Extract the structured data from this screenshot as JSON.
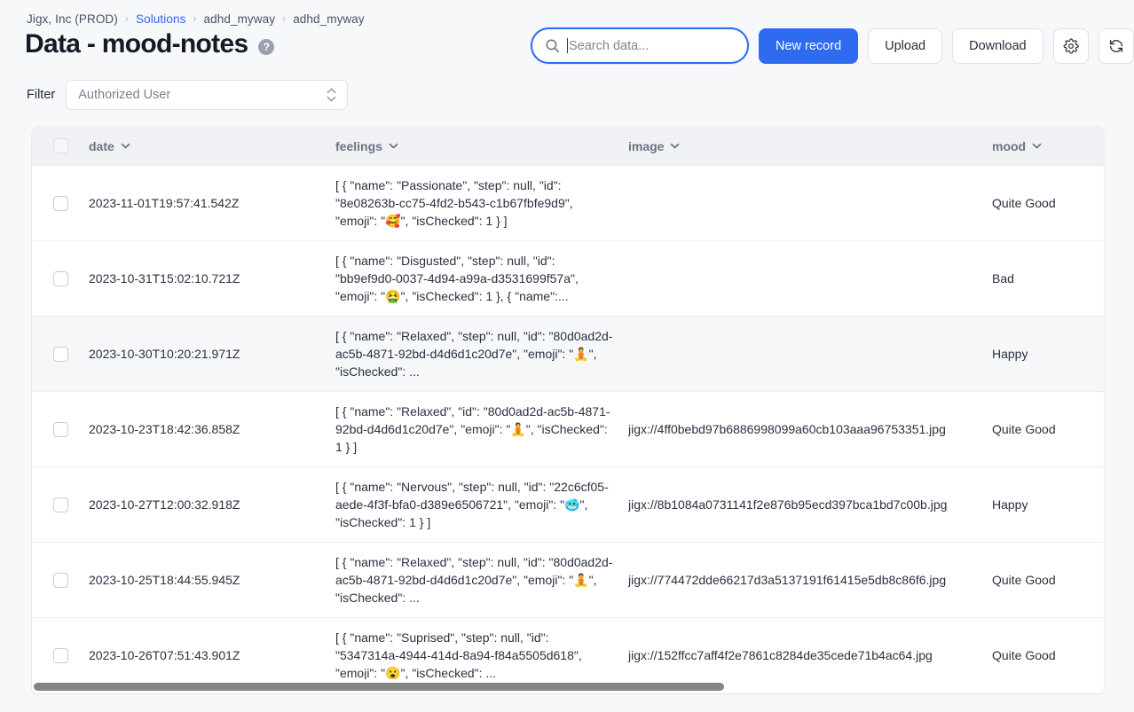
{
  "breadcrumb": {
    "items": [
      {
        "label": "Jigx, Inc (PROD)",
        "link": false
      },
      {
        "label": "Solutions",
        "link": true
      },
      {
        "label": "adhd_myway",
        "link": false
      },
      {
        "label": "adhd_myway",
        "link": false
      }
    ],
    "separator": "›"
  },
  "header": {
    "title": "Data - mood-notes",
    "help_glyph": "?"
  },
  "toolbar": {
    "search": {
      "placeholder": "Search data...",
      "value": "",
      "icon": "search-icon"
    },
    "new_record_label": "New record",
    "upload_label": "Upload",
    "download_label": "Download",
    "settings_icon": "gear-icon",
    "refresh_icon": "refresh-icon"
  },
  "filter": {
    "label": "Filter",
    "value": "Authorized User",
    "options": [
      "Authorized User"
    ]
  },
  "table": {
    "columns": [
      {
        "key": "date",
        "label": "date"
      },
      {
        "key": "feelings",
        "label": "feelings"
      },
      {
        "key": "image",
        "label": "image"
      },
      {
        "key": "mood",
        "label": "mood"
      }
    ],
    "rows": [
      {
        "date": "2023-11-01T19:57:41.542Z",
        "feelings": "[ { \"name\": \"Passionate\", \"step\": null, \"id\": \"8e08263b-cc75-4fd2-b543-c1b67fbfe9d9\", \"emoji\": \"🥰\", \"isChecked\": 1 } ]",
        "image": "",
        "mood": "Quite Good",
        "hover": false
      },
      {
        "date": "2023-10-31T15:02:10.721Z",
        "feelings": "[ { \"name\": \"Disgusted\", \"step\": null, \"id\": \"bb9ef9d0-0037-4d94-a99a-d3531699f57a\", \"emoji\": \"🤮\", \"isChecked\": 1 }, { \"name\":...",
        "image": "",
        "mood": "Bad",
        "hover": false
      },
      {
        "date": "2023-10-30T10:20:21.971Z",
        "feelings": "[ { \"name\": \"Relaxed\", \"step\": null, \"id\": \"80d0ad2d-ac5b-4871-92bd-d4d6d1c20d7e\", \"emoji\": \"🧘\", \"isChecked\": ...",
        "image": "",
        "mood": "Happy",
        "hover": true
      },
      {
        "date": "2023-10-23T18:42:36.858Z",
        "feelings": "[ { \"name\": \"Relaxed\", \"id\": \"80d0ad2d-ac5b-4871-92bd-d4d6d1c20d7e\", \"emoji\": \"🧘\", \"isChecked\": 1 } ]",
        "image": "jigx://4ff0bebd97b6886998099a60cb103aaa96753351.jpg",
        "mood": "Quite Good",
        "hover": false
      },
      {
        "date": "2023-10-27T12:00:32.918Z",
        "feelings": "[ { \"name\": \"Nervous\", \"step\": null, \"id\": \"22c6cf05-aede-4f3f-bfa0-d389e6506721\", \"emoji\": \"🥶\", \"isChecked\": 1 } ]",
        "image": "jigx://8b1084a0731141f2e876b95ecd397bca1bd7c00b.jpg",
        "mood": "Happy",
        "hover": false
      },
      {
        "date": "2023-10-25T18:44:55.945Z",
        "feelings": "[ { \"name\": \"Relaxed\", \"step\": null, \"id\": \"80d0ad2d-ac5b-4871-92bd-d4d6d1c20d7e\", \"emoji\": \"🧘\", \"isChecked\": ...",
        "image": "jigx://774472dde66217d3a5137191f61415e5db8c86f6.jpg",
        "mood": "Quite Good",
        "hover": false
      },
      {
        "date": "2023-10-26T07:51:43.901Z",
        "feelings": "[ { \"name\": \"Suprised\", \"step\": null, \"id\": \"5347314a-4944-414d-8a94-f84a5505d618\", \"emoji\": \"😮\", \"isChecked\": ...",
        "image": "jigx://152ffcc7aff4f2e7861c8284de35cede71b4ac64.jpg",
        "mood": "Quite Good",
        "hover": false
      }
    ]
  },
  "colors": {
    "accent": "#2f6bf0",
    "link": "#3063f2",
    "page_bg": "#f7f8fa",
    "header_bg": "#f0f1f5",
    "row_hover": "#f6f7f9",
    "text": "#2a3140",
    "muted": "#6b7280",
    "scrollbar": "#848484"
  }
}
